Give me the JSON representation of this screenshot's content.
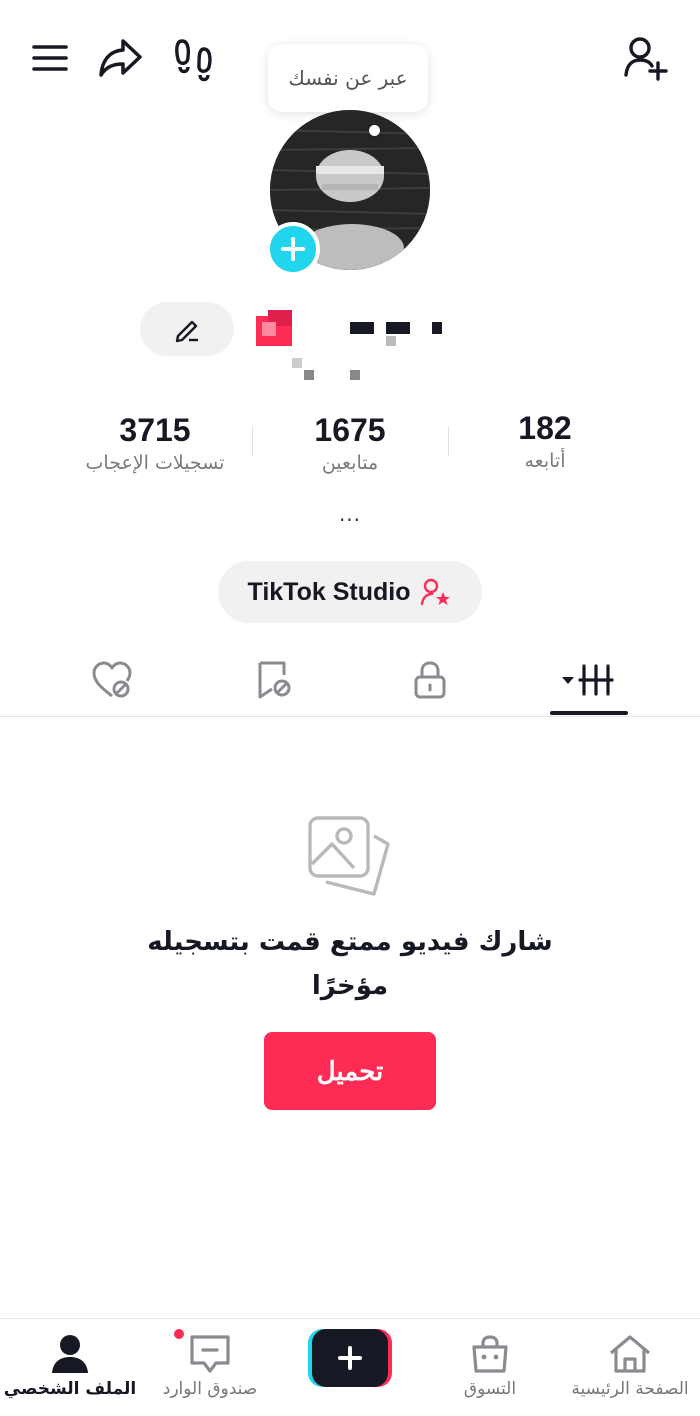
{
  "bio_prompt": "عبر عن نفسك",
  "stats": [
    {
      "value": "3715",
      "label": "تسجيلات الإعجاب"
    },
    {
      "value": "1675",
      "label": "متابعين"
    },
    {
      "value": "182",
      "label": "أتابعه"
    }
  ],
  "bio_more": "...",
  "studio_button": "TikTok Studio",
  "tabs": [
    {
      "icon": "liked-hidden-icon"
    },
    {
      "icon": "favorites-hidden-icon"
    },
    {
      "icon": "lock-icon"
    },
    {
      "icon": "videos-grid-icon",
      "active": true
    }
  ],
  "empty_state": {
    "title": "شارك فيديو ممتع قمت بتسجيله مؤخرًا",
    "upload_button": "تحميل"
  },
  "bottom_nav": {
    "home": "الصفحة الرئيسية",
    "shop": "التسوق",
    "inbox": "صندوق الوارد",
    "profile": "الملف الشخصي"
  },
  "colors": {
    "accent": "#fe2c55",
    "cyan": "#20d5ec",
    "text": "#161823"
  }
}
